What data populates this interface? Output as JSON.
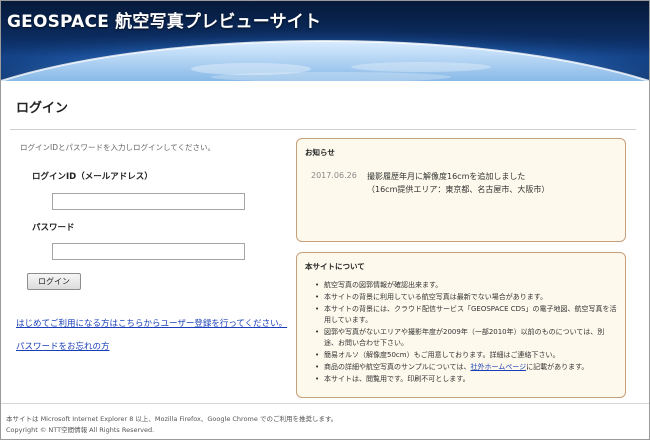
{
  "header": {
    "title": "GEOSPACE 航空写真プレビューサイト"
  },
  "login": {
    "heading": "ログイン",
    "instruction": "ログインIDとパスワードを入力しログインしてください。",
    "id_label": "ログインID（メールアドレス）",
    "id_value": "",
    "password_label": "パスワード",
    "password_value": "",
    "submit_label": "ログイン",
    "register_link": "はじめてご利用になる方はこちらからユーザー登録を行ってください。",
    "forgot_link": "パスワードをお忘れの方"
  },
  "notice": {
    "title": "お知らせ",
    "items": [
      {
        "date": "2017.06.26",
        "line1": "撮影履歴年月に解像度16cmを追加しました",
        "line2": "（16cm提供エリア：東京都、名古屋市、大阪市）"
      }
    ]
  },
  "about": {
    "title": "本サイトについて",
    "items": [
      "航空写真の図郭情報が確認出来ます。",
      "本サイトの背景に利用している航空写真は最新でない場合があります。",
      "本サイトの背景には、クラウド配信サービス「GEOSPACE CDS」の電子地図、航空写真を活用しています。",
      "図郭や写真がないエリアや撮影年度が2009年（一部2010年）以前のものについては、別途、お問い合わせ下さい。",
      "簡易オルソ（解像度50cm）もご用意しております。詳細はご連絡下さい。",
      "本サイトは、閲覧用です。印刷不可とします。"
    ],
    "link_item": {
      "before": "商品の詳細や航空写真のサンプルについては、",
      "link": "社外ホームページ",
      "after": "に記載があります。"
    }
  },
  "footer": {
    "line1": "本サイトは Microsoft Internet Explorer 8 以上、Mozilla Firefox、Google Chrome でのご利用を推奨します。",
    "line2": "Copyright © NTT空間情報 All Rights Reserved."
  },
  "colors": {
    "link": "#1a3fb8",
    "panel_border": "#c79f7a",
    "panel_bg": "#fdf9ec"
  }
}
